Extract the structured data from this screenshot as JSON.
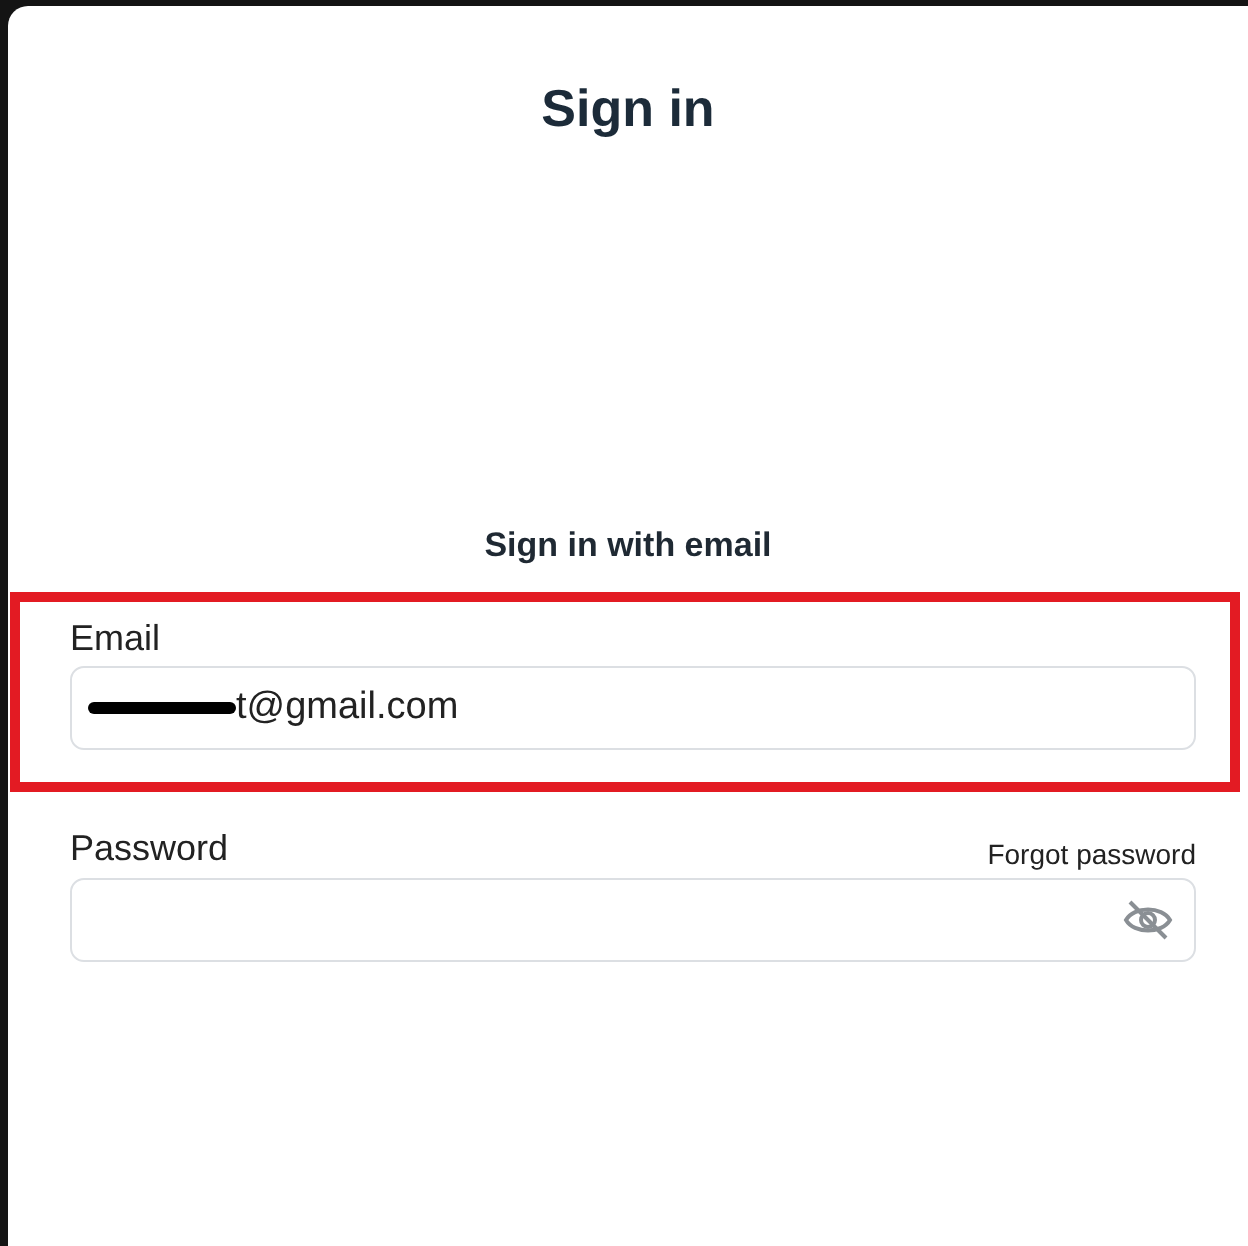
{
  "dialog": {
    "title": "Sign in",
    "subtitle": "Sign in with email"
  },
  "email": {
    "label": "Email",
    "value": "t@gmail.com",
    "redacted": true,
    "highlighted": true
  },
  "password": {
    "label": "Password",
    "forgot_link": "Forgot password",
    "visible": false
  }
}
